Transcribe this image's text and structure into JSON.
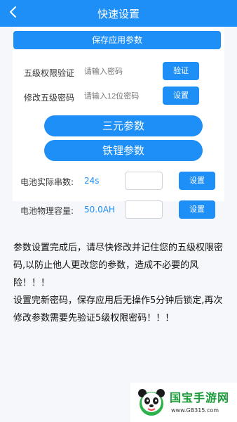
{
  "header": {
    "title": "快速设置",
    "back_icon": "chevron-left-icon"
  },
  "save_button_label": "保存应用参数",
  "verify_row": {
    "label": "五级权限验证",
    "placeholder": "请输入密码",
    "button_label": "验证"
  },
  "change_password_row": {
    "label": "修改五级密码",
    "placeholder": "请输入12位密码",
    "button_label": "设置"
  },
  "ternary_button_label": "三元参数",
  "lithium_button_label": "铁锂参数",
  "series_row": {
    "label": "电池实际串数:",
    "value": "24s",
    "button_label": "设置"
  },
  "capacity_row": {
    "label": "电池物理容量:",
    "value": "50.0AH",
    "button_label": "设置"
  },
  "notice": {
    "paragraph1": "参数设置完成后，请尽快修改并记住您的五级权限密码,以防止他人更改您的参数，造成不必要的风险！！！",
    "paragraph2": "设置完新密码，保存应用后无操作5分钟后锁定,再次修改参数需要先验证5级权限密码！！！"
  },
  "watermark": {
    "title": "国宝手游网",
    "url": "www.GB315.com"
  },
  "colors": {
    "accent": "#1e8ff6",
    "background": "#f6f7fb",
    "watermark_green": "#1a9b3a"
  }
}
